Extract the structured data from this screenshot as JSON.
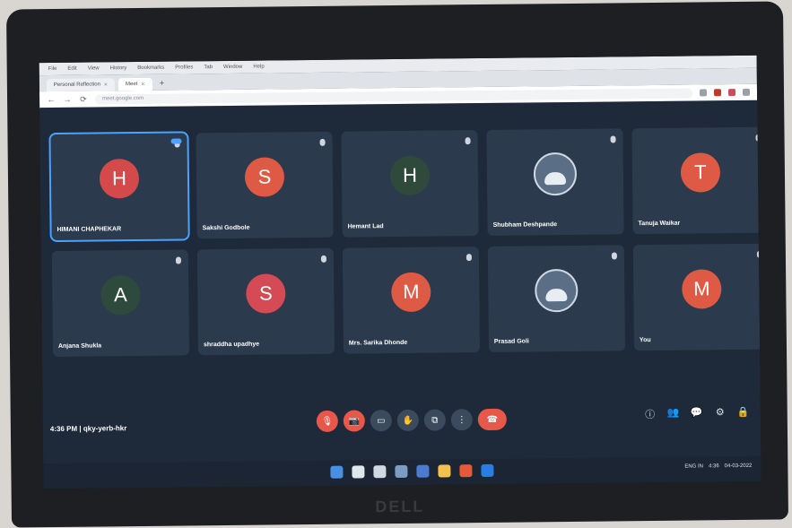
{
  "browser": {
    "menu": [
      "File",
      "Edit",
      "View",
      "History",
      "Bookmarks",
      "Profiles",
      "Tab",
      "Window",
      "Help"
    ],
    "tabs": [
      {
        "label": "Personal Reflection"
      },
      {
        "label": "Meet"
      }
    ],
    "url": "meet.google.com"
  },
  "meeting": {
    "tiles": [
      {
        "initial": "H",
        "name": "HIMANI CHAPHEKAR",
        "color": "#d44a4a",
        "active": true
      },
      {
        "initial": "S",
        "name": "Sakshi Godbole",
        "color": "#de5a44"
      },
      {
        "initial": "H",
        "name": "Hemant Lad",
        "color": "#2f4a3a"
      },
      {
        "initial": "",
        "name": "Shubham Deshpande",
        "photo": true
      },
      {
        "initial": "T",
        "name": "Tanuja Waikar",
        "color": "#de5a44"
      },
      {
        "initial": "A",
        "name": "Anjana Shukla",
        "color": "#2d4a3c"
      },
      {
        "initial": "S",
        "name": "shraddha upadhye",
        "color": "#d44a55"
      },
      {
        "initial": "M",
        "name": "Mrs. Sarika Dhonde",
        "color": "#de5a44"
      },
      {
        "initial": "",
        "name": "Prasad Goli",
        "photo": true
      },
      {
        "initial": "M",
        "name": "You",
        "color": "#de5a44"
      }
    ],
    "time": "4:36 PM",
    "separator": "|",
    "meeting_code": "qky-yerb-hkr"
  },
  "controls": {
    "mic_icon": "mic-icon",
    "camera_icon": "camera-icon",
    "captions_icon": "captions-icon",
    "hand_icon": "hand-icon",
    "present_icon": "present-icon",
    "more_icon": "more-icon",
    "leave_icon": "leave-call-icon"
  },
  "right_controls": [
    "info-icon",
    "people-icon",
    "chat-icon",
    "activities-icon",
    "lock-icon"
  ],
  "taskbar": {
    "clock": "4:36",
    "date": "04-03-2022",
    "lang": "ENG IN"
  }
}
